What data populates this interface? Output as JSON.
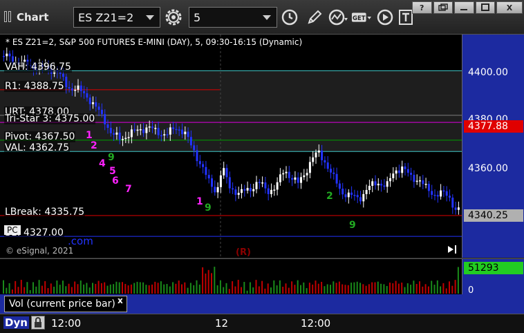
{
  "window": {
    "title": "Chart",
    "controls": {
      "help": "?",
      "restore": "",
      "minimize": "",
      "maximize": "",
      "close": "X"
    }
  },
  "toolbar": {
    "symbol": "ES Z21=2",
    "interval": "5",
    "icons": [
      "gear-icon",
      "clock-icon",
      "pencil-icon",
      "indicator-icon",
      "get-icon",
      "play-icon",
      "text-icon"
    ],
    "get_label": "GET"
  },
  "chart": {
    "header": "* ES Z21=2, S&P 500 FUTURES E-MINI (DAY), 5, 09:30-16:15 (Dynamic)",
    "copyright": "© eSignal, 2021",
    "com_text": ".com",
    "pc_tag": "PC",
    "r_marker": "(R)",
    "levels": [
      {
        "key": "vah",
        "label": "VAH: 4396.75",
        "price": 4396.75,
        "color": "#40c8c8"
      },
      {
        "key": "r1",
        "label": "R1: 4388.75",
        "price": 4388.75,
        "color": "#e00000"
      },
      {
        "key": "urt",
        "label": "URT: 4378.00",
        "price": 4378.0,
        "color": "#808080"
      },
      {
        "key": "tristar",
        "label": "Tri-Star 3: 4375.00",
        "price": 4375.0,
        "color": "#e000e0"
      },
      {
        "key": "pivot",
        "label": "Pivot: 4367.50",
        "price": 4367.5,
        "color": "#00a000"
      },
      {
        "key": "val",
        "label": "VAL: 4362.75",
        "price": 4362.75,
        "color": "#40c8c8"
      },
      {
        "key": "lbreak",
        "label": "LBreak: 4335.75",
        "price": 4335.75,
        "color": "#e00000"
      },
      {
        "key": "s1",
        "label": "S1: 4327.00",
        "price": 4327.0,
        "color": "#2233ff"
      }
    ]
  },
  "price_axis": {
    "labels": [
      "4400.00",
      "4380.00",
      "4360.00"
    ],
    "current_price": "4340.25",
    "tristar_tag": "4377.88",
    "colors": {
      "current": "#b0b0b0",
      "tristar_tag": "#e00000"
    }
  },
  "volume": {
    "current": "51293",
    "zero": "0",
    "colors": {
      "tag": "#22cc22",
      "bars": "#c00000"
    }
  },
  "study": {
    "label": "Vol (current price bar)",
    "close": "x"
  },
  "time_axis": {
    "mode": "Dyn",
    "labels": [
      "12:00",
      "12",
      "12:00"
    ]
  },
  "colors": {
    "up_bar": "#ffffff",
    "down_bar": "#2233ff",
    "axis_bg": "#1c2aa0",
    "count_magenta": "#ff22ff",
    "count_green": "#22aa22"
  }
}
